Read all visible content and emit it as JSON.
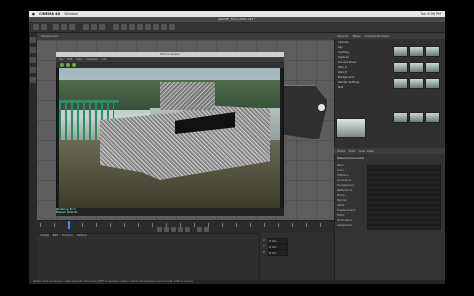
{
  "mac_menu": {
    "app": "CINEMA 4D",
    "menu": "Window",
    "clock": "Tue 6:06 PM"
  },
  "window": {
    "title": "Rebirth_Final_2021.c4d *"
  },
  "viewport": {
    "label": "Perspective"
  },
  "render_window": {
    "title": "Picture Viewer",
    "menu": [
      "File",
      "Edit",
      "View",
      "Compare",
      "Info"
    ],
    "status_lines": [
      "Rendering: 81 %",
      "Elapsed: 00:00:41",
      "Size: 1920x1080 - RGB (8 Bit)"
    ]
  },
  "object_manager": {
    "tabs": [
      "Objects",
      "Takes",
      "Content Browser"
    ],
    "items": [
      "Camera",
      "Sky",
      "Lighting",
      "Stadium",
      "Ground Plane",
      "Wall_A",
      "Wall_B",
      "Background",
      "Render Settings",
      "Null"
    ]
  },
  "attributes": {
    "tabs": [
      "Mode",
      "Edit",
      "User Data"
    ],
    "header": "Material [Concrete]",
    "rows": [
      {
        "label": "Basic",
        "value": ""
      },
      {
        "label": "Color",
        "value": ""
      },
      {
        "label": "Diffusion",
        "value": ""
      },
      {
        "label": "Luminance",
        "value": ""
      },
      {
        "label": "Transparency",
        "value": ""
      },
      {
        "label": "Reflectance",
        "value": ""
      },
      {
        "label": "Bump",
        "value": ""
      },
      {
        "label": "Normal",
        "value": ""
      },
      {
        "label": "Alpha",
        "value": ""
      },
      {
        "label": "Displacement",
        "value": ""
      },
      {
        "label": "Editor",
        "value": ""
      },
      {
        "label": "Illumination",
        "value": ""
      },
      {
        "label": "Assignment",
        "value": ""
      }
    ]
  },
  "materials": {
    "menu": [
      "Create",
      "Edit",
      "Function",
      "Texture"
    ]
  },
  "coordinates": {
    "labels": [
      "X",
      "Y",
      "Z"
    ],
    "values": [
      "0 cm",
      "0 cm",
      "0 cm"
    ]
  },
  "status": {
    "text": "Rotate: Click and drag to rotate elements. Hold down SHIFT to quantize rotation / add to the selection in point mode, CTRL to remove."
  },
  "colors": {
    "accent": "#3c8cff",
    "background": "#3a3a3a"
  }
}
